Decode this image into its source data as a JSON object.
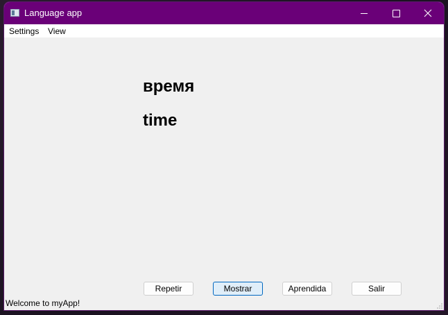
{
  "window": {
    "title": "Language app"
  },
  "menu": {
    "items": [
      "Settings",
      "View"
    ]
  },
  "flashcard": {
    "word": "время",
    "translation": "time"
  },
  "buttons": [
    "Repetir",
    "Mostrar",
    "Aprendida",
    "Salir"
  ],
  "status": {
    "text": "Welcome to myApp!"
  },
  "colors": {
    "titlebar": "#6a0078",
    "focus_border": "#0067c0"
  },
  "icons": [
    "app-icon",
    "minimize-icon",
    "maximize-icon",
    "close-icon",
    "size-grip-icon"
  ]
}
